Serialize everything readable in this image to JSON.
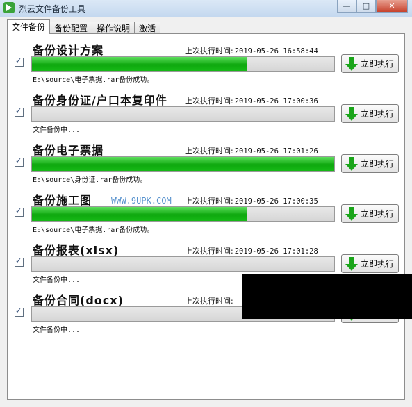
{
  "window": {
    "title": "烈云文件备份工具"
  },
  "tabs": [
    {
      "label": "文件备份",
      "active": true
    },
    {
      "label": "备份配置",
      "active": false
    },
    {
      "label": "操作说明",
      "active": false
    },
    {
      "label": "激活",
      "active": false
    }
  ],
  "last_run_label": "上次执行时间:",
  "run_button_label": "立即执行",
  "tasks": [
    {
      "name": "备份设计方案",
      "checked": true,
      "last_run": "2019-05-26 16:58:44",
      "progress": 0.71,
      "status": "E:\\source\\电子票据.rar备份成功。"
    },
    {
      "name": "备份身份证/户口本复印件",
      "checked": true,
      "last_run": "2019-05-26 17:00:36",
      "progress": 0.0,
      "status": "文件备份中..."
    },
    {
      "name": "备份电子票据",
      "checked": true,
      "last_run": "2019-05-26 17:01:26",
      "progress": 1.0,
      "status": "E:\\source\\身份证.rar备份成功。"
    },
    {
      "name": "备份施工图",
      "checked": true,
      "last_run": "2019-05-26 17:00:35",
      "progress": 0.71,
      "status": "E:\\source\\电子票据.rar备份成功。"
    },
    {
      "name": "备份报表(xlsx)",
      "checked": true,
      "last_run": "2019-05-26 17:01:28",
      "progress": 0.0,
      "status": "文件备份中..."
    },
    {
      "name": "备份合同(docx)",
      "checked": true,
      "last_run": "",
      "progress": 0.0,
      "status": "文件备份中..."
    }
  ],
  "watermark": "WWW.9UPK.COM",
  "colors": {
    "progress_green": "#0ea80e",
    "titlebar": "#c4d8ef"
  }
}
